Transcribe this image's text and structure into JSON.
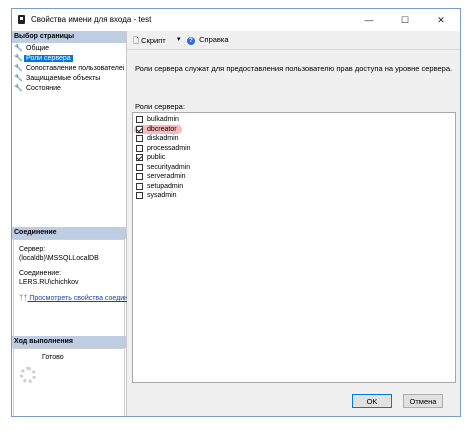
{
  "window": {
    "title": "Свойства имени для входа - test"
  },
  "titlebar_buttons": {
    "minimize": "—",
    "maximize": "☐",
    "close": "✕"
  },
  "left_pane": {
    "select_page_header": "Выбор страницы",
    "pages": [
      {
        "label": "Общие",
        "selected": false
      },
      {
        "label": "Роли сервера",
        "selected": true
      },
      {
        "label": "Сопоставление пользователей",
        "selected": false
      },
      {
        "label": "Защищаемые объекты",
        "selected": false
      },
      {
        "label": "Состояние",
        "selected": false
      }
    ],
    "connection_header": "Соединение",
    "server_label": "Сервер:",
    "server_value": "(localdb)\\MSSQLLocalDB",
    "connection_label": "Соединение:",
    "connection_value": "LERS.RU\\chichkov",
    "view_connection_link": "Просмотреть свойства соединения",
    "progress_header": "Ход выполнения",
    "progress_status": "Готово"
  },
  "toolbar": {
    "script_label": "Скрипт",
    "help_label": "Справка",
    "dropdown_arrow": "▾"
  },
  "main": {
    "description": "Роли сервера служат для предоставления пользователю прав доступа на уровне сервера.",
    "roles_label": "Роли сервера:",
    "roles": [
      {
        "name": "bulkadmin",
        "checked": false
      },
      {
        "name": "dbcreator",
        "checked": true,
        "highlighted": true
      },
      {
        "name": "diskadmin",
        "checked": false
      },
      {
        "name": "processadmin",
        "checked": false
      },
      {
        "name": "public",
        "checked": true
      },
      {
        "name": "securityadmin",
        "checked": false
      },
      {
        "name": "serveradmin",
        "checked": false
      },
      {
        "name": "setupadmin",
        "checked": false
      },
      {
        "name": "sysadmin",
        "checked": false
      }
    ]
  },
  "footer": {
    "ok_label": "OK",
    "cancel_label": "Отмена"
  }
}
